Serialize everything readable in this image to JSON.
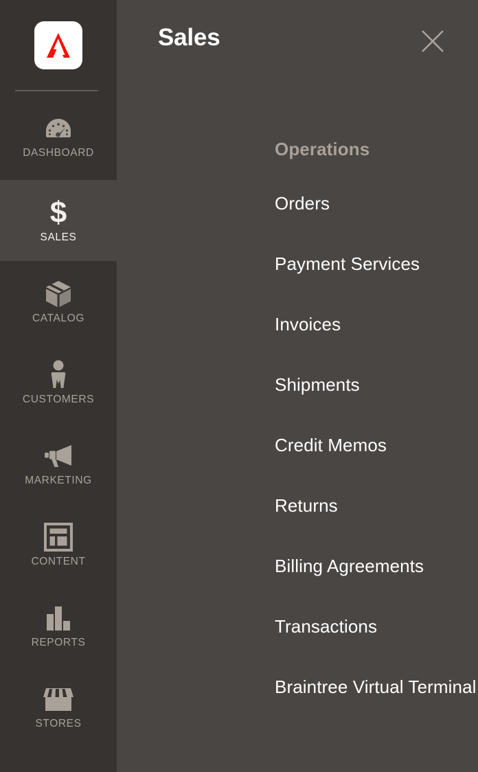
{
  "theme": {
    "sidebar_bg": "#373330",
    "panel_bg": "#4a4643",
    "accent_red": "#fa0f00",
    "muted_text": "#a8a29a",
    "section_title_color": "#a9a199",
    "item_text": "#ffffff"
  },
  "sidebar": {
    "logo": {
      "icon": "adobe-logo-icon",
      "alt": "Adobe"
    },
    "items": [
      {
        "label": "DASHBOARD",
        "icon": "gauge-icon",
        "active": false
      },
      {
        "label": "SALES",
        "icon": "dollar-sign-icon",
        "active": true
      },
      {
        "label": "CATALOG",
        "icon": "box-icon",
        "active": false
      },
      {
        "label": "CUSTOMERS",
        "icon": "person-icon",
        "active": false
      },
      {
        "label": "MARKETING",
        "icon": "megaphone-icon",
        "active": false
      },
      {
        "label": "CONTENT",
        "icon": "layout-icon",
        "active": false
      },
      {
        "label": "REPORTS",
        "icon": "bar-chart-icon",
        "active": false
      },
      {
        "label": "STORES",
        "icon": "storefront-icon",
        "active": false
      }
    ]
  },
  "panel": {
    "title": "Sales",
    "close_icon": "close-icon",
    "sections": [
      {
        "title": "Operations",
        "items": [
          {
            "label": "Orders"
          },
          {
            "label": "Payment Services"
          },
          {
            "label": "Invoices"
          },
          {
            "label": "Shipments"
          },
          {
            "label": "Credit Memos"
          },
          {
            "label": "Returns"
          },
          {
            "label": "Billing Agreements"
          },
          {
            "label": "Transactions"
          },
          {
            "label": "Braintree Virtual Terminal"
          }
        ]
      }
    ]
  }
}
